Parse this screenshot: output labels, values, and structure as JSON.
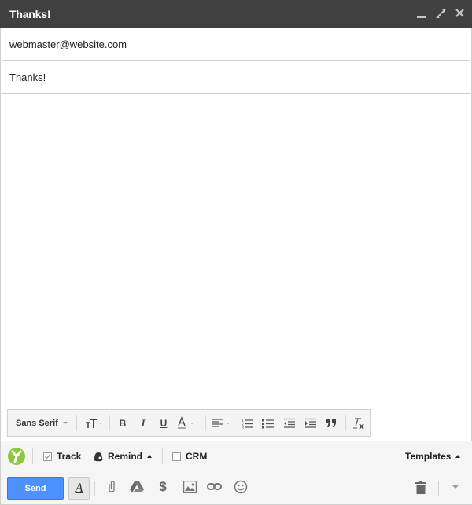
{
  "window": {
    "title": "Thanks!",
    "controls": {
      "minimize": "minimize",
      "popout": "pop-out",
      "close": "close"
    }
  },
  "compose": {
    "to_value": "webmaster@website.com",
    "subject_value": "Thanks!",
    "body_value": ""
  },
  "format_toolbar": {
    "font_family": "Sans Serif",
    "items": [
      "font-size",
      "bold",
      "italic",
      "underline",
      "text-color",
      "align",
      "numbered-list",
      "bulleted-list",
      "indent-less",
      "indent-more",
      "quote",
      "remove-formatting"
    ]
  },
  "extension_bar": {
    "logo": "yesware-logo",
    "track_label": "Track",
    "track_checked": true,
    "remind_label": "Remind",
    "crm_label": "CRM",
    "crm_checked": false,
    "templates_label": "Templates",
    "brand_color": "#8dc63f"
  },
  "action_bar": {
    "send_label": "Send",
    "send_color": "#4d90fe",
    "format_toggle_label": "A"
  }
}
